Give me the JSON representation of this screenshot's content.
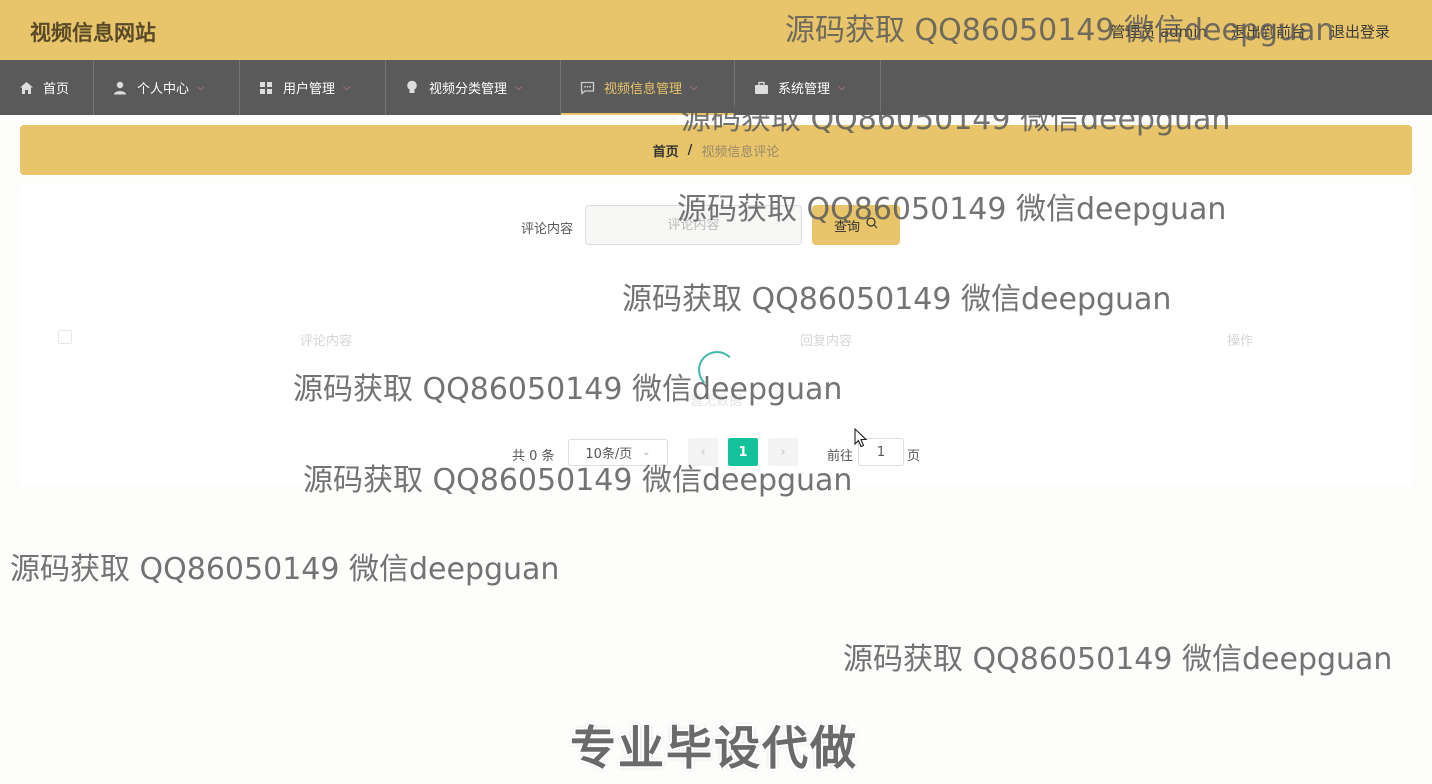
{
  "header": {
    "site_title": "视频信息网站",
    "user_label": "管理员 admin",
    "to_frontend": "退出到前台",
    "logout": "退出登录",
    "bg_color": "#e8c46a"
  },
  "nav": {
    "items": [
      {
        "label": "首页",
        "icon": "home-icon"
      },
      {
        "label": "个人中心",
        "icon": "user-icon"
      },
      {
        "label": "用户管理",
        "icon": "grid-icon"
      },
      {
        "label": "视频分类管理",
        "icon": "bulb-icon"
      },
      {
        "label": "视频信息管理",
        "icon": "chat-icon"
      },
      {
        "label": "系统管理",
        "icon": "briefcase-icon"
      }
    ],
    "active_index": 4
  },
  "breadcrumb": {
    "home": "首页",
    "separator": "/",
    "current": "视频信息评论"
  },
  "search": {
    "label": "评论内容",
    "placeholder": "评论内容",
    "button": "查询"
  },
  "table": {
    "columns": [
      "评论内容",
      "回复内容",
      "操作"
    ],
    "empty_text": "暂无数据"
  },
  "pagination": {
    "total": "共 0 条",
    "page_size": "10条/页",
    "current_page": "1",
    "goto_label": "前往",
    "goto_value": "1",
    "goto_suffix": "页"
  },
  "overlay": {
    "watermark": "源码获取 QQ86050149 微信deepguan",
    "slogan": "专业毕设代做"
  }
}
